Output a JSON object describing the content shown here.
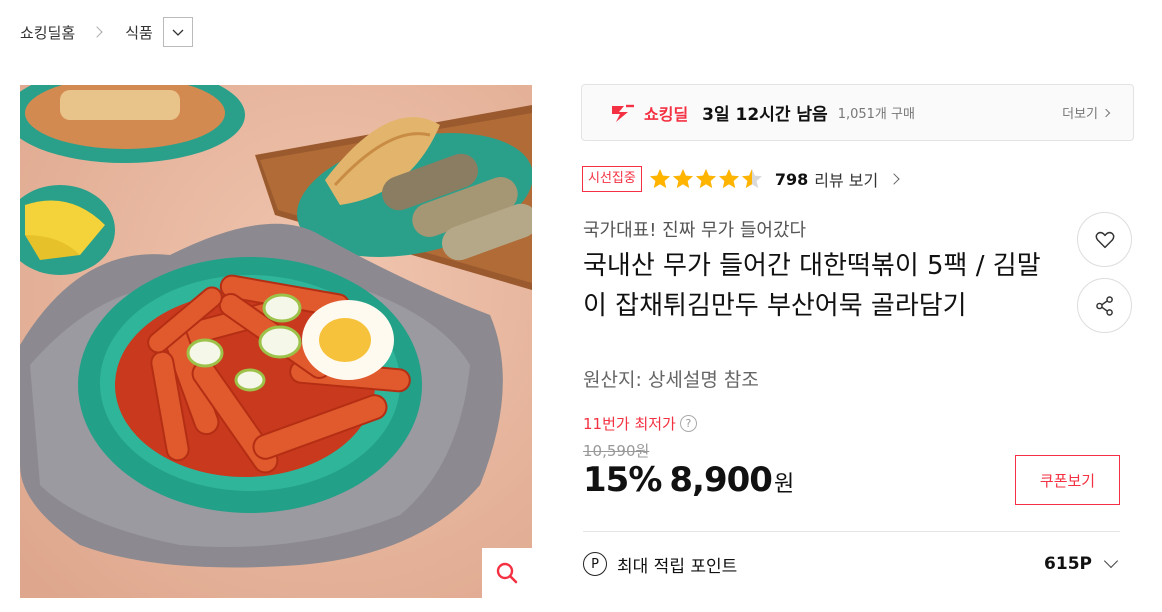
{
  "breadcrumb": {
    "home": "쇼킹딜홈",
    "category": "식품"
  },
  "deal": {
    "brand": "쇼킹딜",
    "time_left": "3일 12시간 남음",
    "sold": "1,051개 구매",
    "more": "더보기",
    "accent_color": "#f43142"
  },
  "rating": {
    "badge": "시선집중",
    "stars": 4.5,
    "review_count": "798",
    "review_label": "리뷰 보기",
    "star_color": "#ffb400"
  },
  "product": {
    "subtitle": "국가대표! 진짜 무가 들어갔다",
    "title": "국내산 무가 들어간 대한떡볶이 5팩 / 김말이 잡채튀김만두 부산어묵 골라담기",
    "origin": "원산지:  상세설명 참조"
  },
  "price": {
    "best_label": "11번가 최저가",
    "help": "?",
    "original": "10,590원",
    "discount": "15%",
    "final": "8,900",
    "currency": "원",
    "coupon_button": "쿠폰보기"
  },
  "points": {
    "icon": "P",
    "label": "최대 적립 포인트",
    "value": "615P"
  },
  "icons": {
    "like": "heart-icon",
    "share": "share-icon",
    "zoom": "magnifier-icon"
  }
}
